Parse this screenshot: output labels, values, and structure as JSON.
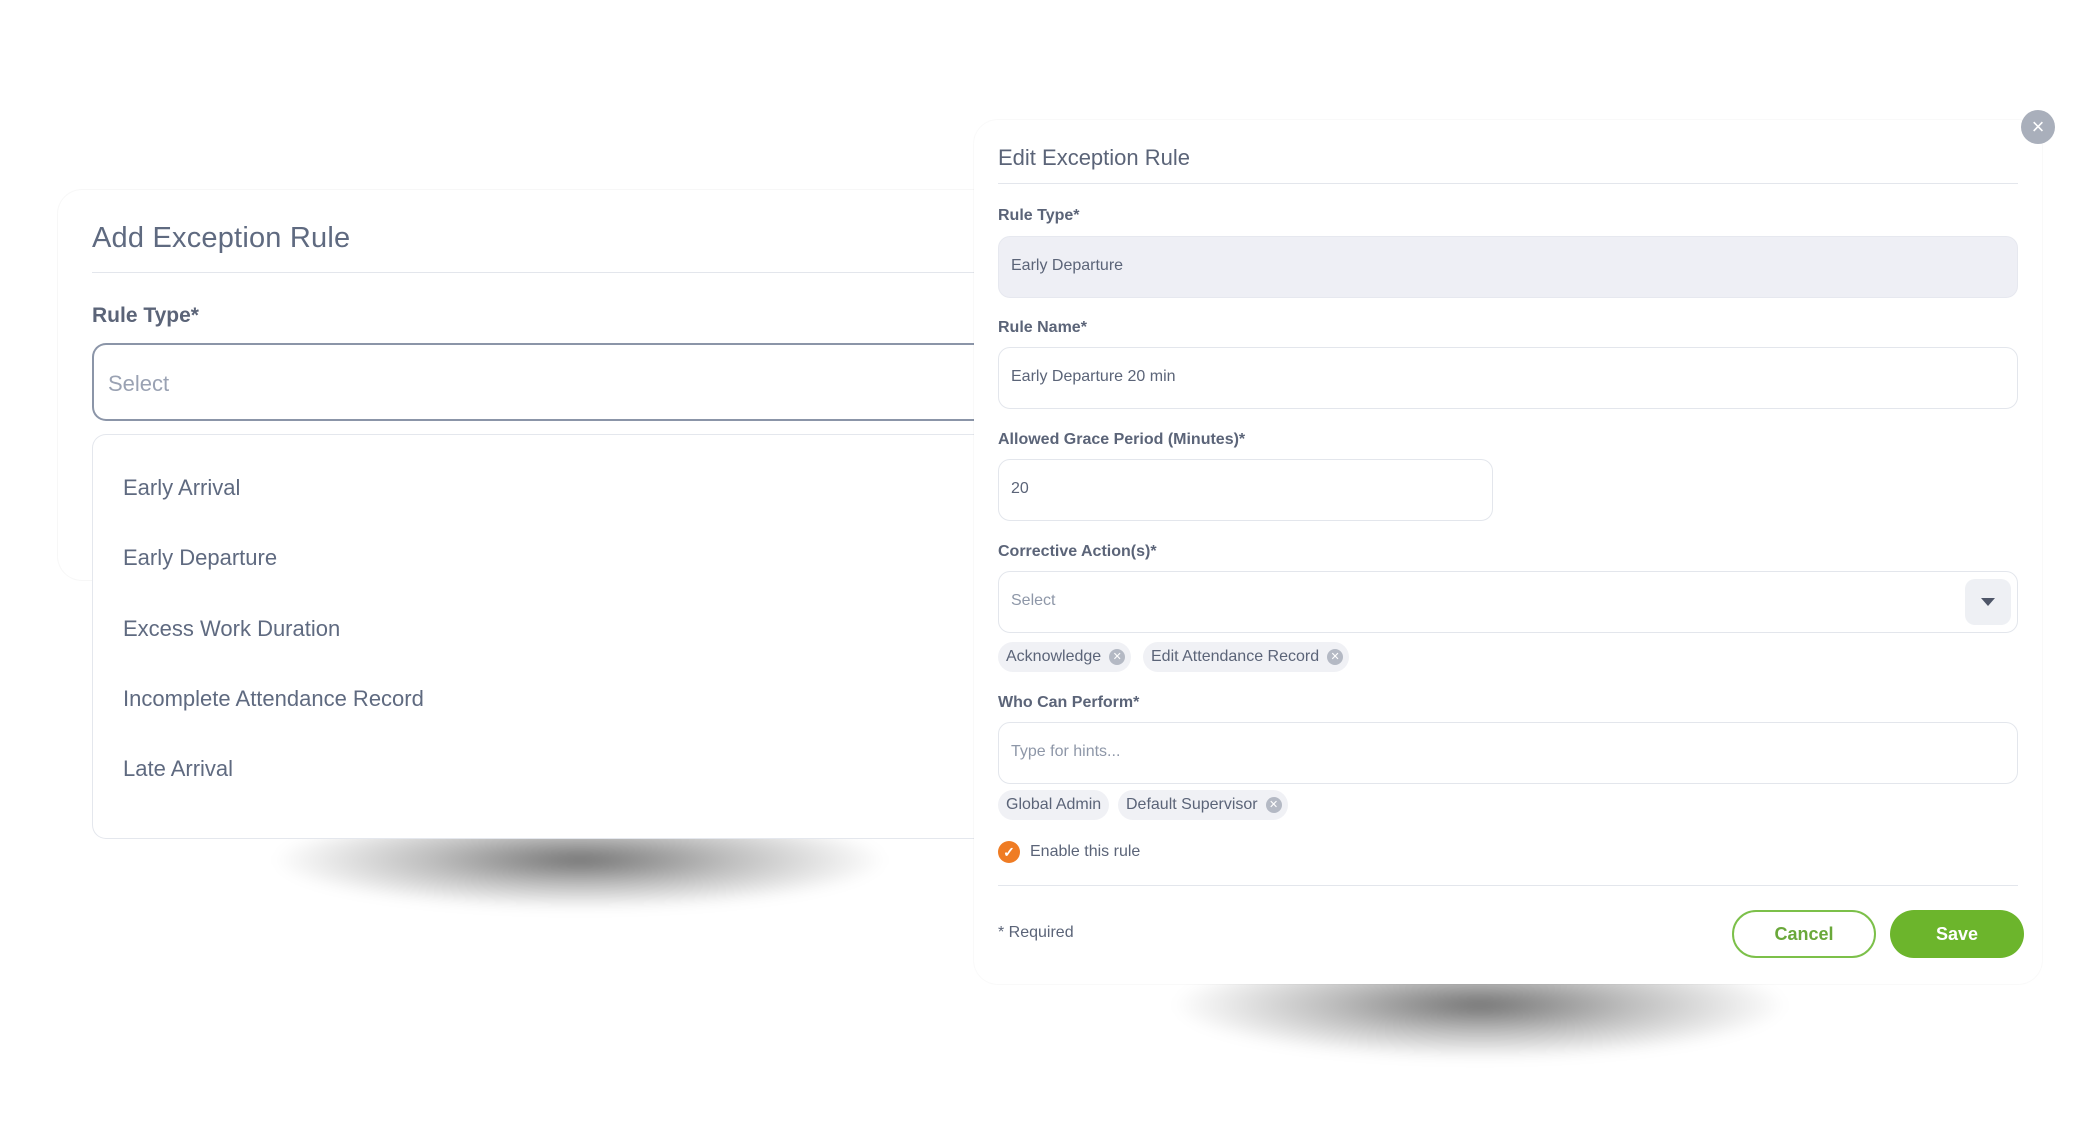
{
  "add_modal": {
    "title": "Add Exception Rule",
    "rule_type_label": "Rule Type*",
    "rule_type_placeholder": "Select",
    "options": [
      "Early Arrival",
      "Early Departure",
      "Excess Work Duration",
      "Incomplete Attendance Record",
      "Late Arrival"
    ]
  },
  "edit_modal": {
    "title": "Edit Exception Rule",
    "close_icon": "×",
    "rule_type": {
      "label": "Rule Type*",
      "value": "Early Departure"
    },
    "rule_name": {
      "label": "Rule Name*",
      "value": "Early Departure  20 min"
    },
    "grace_period": {
      "label": "Allowed Grace Period (Minutes)*",
      "value": "20"
    },
    "corrective_actions": {
      "label": "Corrective Action(s)*",
      "placeholder": "Select",
      "chips": [
        "Acknowledge",
        "Edit Attendance Record"
      ]
    },
    "who_can_perform": {
      "label": "Who Can Perform*",
      "placeholder": "Type for hints...",
      "chips": [
        "Global Admin",
        "Default Supervisor"
      ]
    },
    "enable_label": "Enable this rule",
    "enabled": true,
    "required_note": "* Required",
    "cancel_label": "Cancel",
    "save_label": "Save"
  },
  "colors": {
    "accent_green": "#6cb52c",
    "checkbox_orange": "#ef7c24",
    "text": "#5b6478"
  }
}
